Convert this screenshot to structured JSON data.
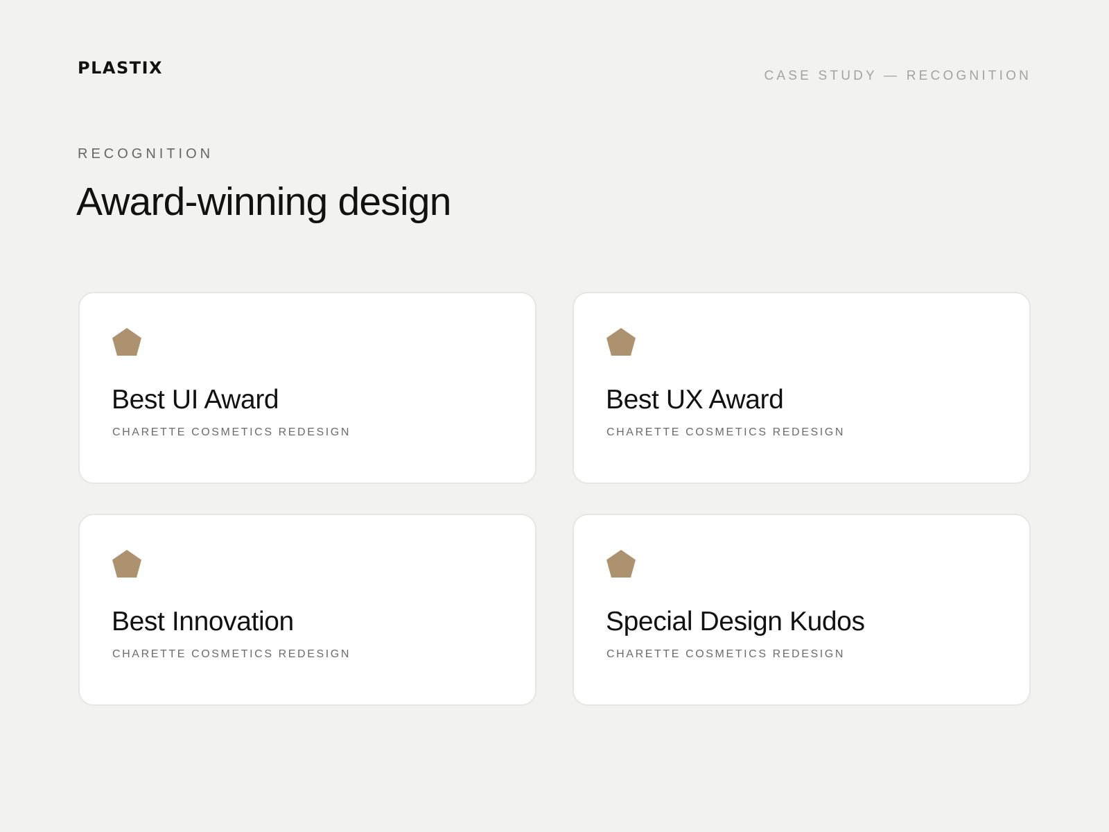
{
  "header": {
    "logo_text": "PLASTIX",
    "meta_text": "CASE STUDY — RECOGNITION"
  },
  "section": {
    "eyebrow": "RECOGNITION",
    "title": "Award-winning design"
  },
  "theme": {
    "background": "#f2f2f0",
    "card_background": "#ffffff",
    "accent": "#ad9270"
  },
  "awards": [
    {
      "icon": "pentagon-award-icon",
      "title": "Best UI Award",
      "subtitle": "CHARETTE COSMETICS REDESIGN"
    },
    {
      "icon": "pentagon-award-icon",
      "title": "Best UX Award",
      "subtitle": "CHARETTE COSMETICS REDESIGN"
    },
    {
      "icon": "pentagon-award-icon",
      "title": "Best Innovation",
      "subtitle": "CHARETTE COSMETICS REDESIGN"
    },
    {
      "icon": "pentagon-award-icon",
      "title": "Special Design Kudos",
      "subtitle": "CHARETTE COSMETICS REDESIGN"
    }
  ]
}
